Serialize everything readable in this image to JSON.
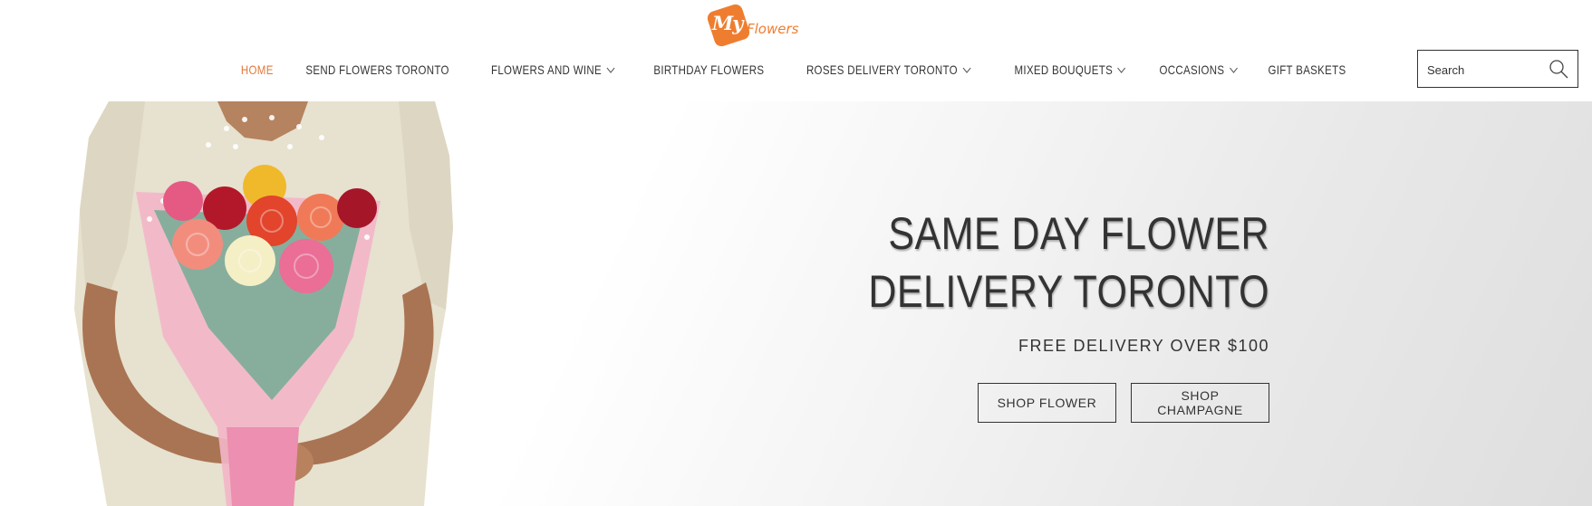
{
  "brand": {
    "logo_prefix": "My",
    "logo_word": "Flowers",
    "accent_color": "#ef7d2f"
  },
  "nav": {
    "items": [
      {
        "label": "HOME",
        "active": true,
        "dropdown": false
      },
      {
        "label": "SEND FLOWERS TORONTO",
        "active": false,
        "dropdown": false
      },
      {
        "label": "FLOWERS AND WINE",
        "active": false,
        "dropdown": true
      },
      {
        "label": "BIRTHDAY FLOWERS",
        "active": false,
        "dropdown": false
      },
      {
        "label": "ROSES DELIVERY TORONTO",
        "active": false,
        "dropdown": true
      },
      {
        "label": "MIXED BOUQUETS",
        "active": false,
        "dropdown": true
      },
      {
        "label": "OCCASIONS",
        "active": false,
        "dropdown": true
      },
      {
        "label": "GIFT BASKETS",
        "active": false,
        "dropdown": false
      }
    ]
  },
  "search": {
    "placeholder": "Search",
    "icon": "search-icon"
  },
  "hero": {
    "title": "SAME DAY FLOWER DELIVERY TORONTO",
    "subtitle": "FREE DELIVERY OVER $100",
    "buttons": {
      "shop_flower": "SHOP FLOWER",
      "shop_champagne": "SHOP CHAMPAGNE"
    }
  }
}
